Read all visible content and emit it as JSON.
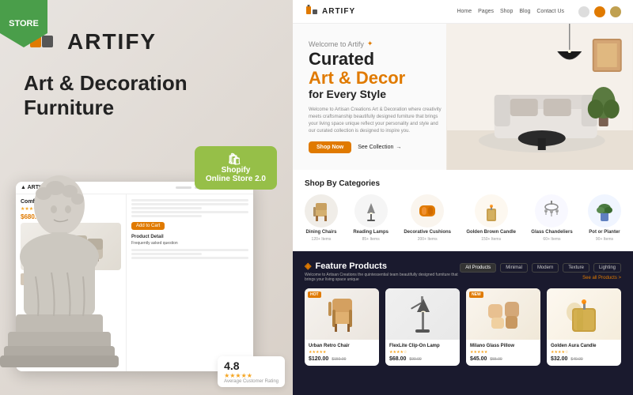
{
  "left": {
    "store_badge": "STORE",
    "brand_name": "ARTIFY",
    "tagline_line1": "Art & Decoration",
    "tagline_line2": "Furniture",
    "shopify_badge_line1": "Shopify",
    "shopify_badge_line2": "Online Store 2.0",
    "product_title": "Comfort Haven Sofa",
    "product_reviews": "30 Reviews",
    "product_price": "$680.00",
    "rating_score": "4.8",
    "rating_label": "Average Customer Rating",
    "product_detail_label": "Product Detail",
    "faq_label": "Frequently asked question"
  },
  "right": {
    "nav": {
      "logo": "ARTIFY",
      "items": [
        "Home",
        "Pages",
        "Shop",
        "Blog",
        "Contact Us"
      ]
    },
    "hero": {
      "subtitle": "Welcome to Artify",
      "title_line1": "Curated",
      "title_line2": "Art & Decor",
      "title_line3": "for Every Style",
      "description": "Welcome to Artisan Creations Art & Decoration where creativity meets craftsmanship beautifully designed furniture that brings your living space unique reflect your personality and style and our curated collection is designed to inspire you.",
      "btn_shop": "Shop Now",
      "btn_collection": "See Collection"
    },
    "categories": {
      "title": "Shop By Categories",
      "items": [
        {
          "label": "Dining Chairs",
          "count": "120+ Items"
        },
        {
          "label": "Reading Lamps",
          "count": "85+ Items"
        },
        {
          "label": "Decorative Cushions",
          "count": "200+ Items"
        },
        {
          "label": "Golden Brown Candle",
          "count": "150+ Items"
        },
        {
          "label": "Glass Chandeliers",
          "count": "60+ Items"
        },
        {
          "label": "Pot or Planter",
          "count": "90+ Items"
        }
      ]
    },
    "feature": {
      "title": "Feature Products",
      "description": "Welcome to Artisan Creations the quintessential team beautifully designed furniture that brings your living space unique",
      "filters": [
        "All Products",
        "Minimal",
        "Modern",
        "Texture",
        "Lighting"
      ],
      "see_all": "See all Products >",
      "products": [
        {
          "name": "Urban Retro Chair",
          "badge": "HOT",
          "price": "$120.00",
          "old_price": "$150.00",
          "stars": "★★★★★"
        },
        {
          "name": "FlexLite Clip-On Lamp",
          "badge": "",
          "price": "$68.00",
          "old_price": "$90.00",
          "stars": "★★★★☆"
        },
        {
          "name": "Milano Glass Pillow",
          "badge": "NEW",
          "price": "$45.00",
          "old_price": "$55.00",
          "stars": "★★★★★"
        },
        {
          "name": "Golden Aura Candle",
          "badge": "",
          "price": "$32.00",
          "old_price": "$40.00",
          "stars": "★★★★☆"
        }
      ]
    }
  }
}
